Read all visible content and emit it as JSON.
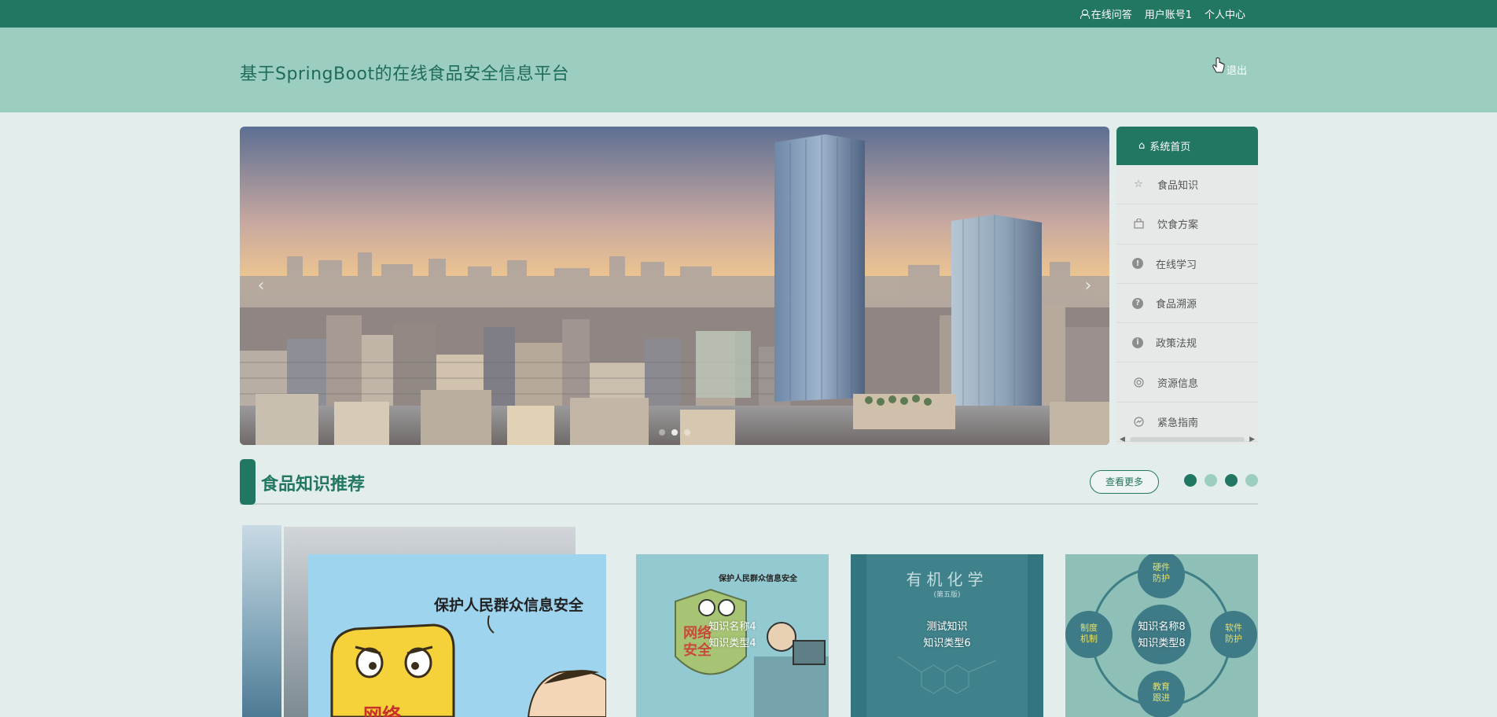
{
  "topbar": {
    "qa_label": "在线问答",
    "account_label": "用户账号1",
    "profile_label": "个人中心"
  },
  "header": {
    "site_title": "基于SpringBoot的在线食品安全信息平台",
    "logout_label": "退出"
  },
  "banner": {
    "prev_label": "‹",
    "next_label": "›",
    "slide_count": 3,
    "active_slide": 2
  },
  "sidemenu": {
    "home_label": "系统首页",
    "items": [
      {
        "label": "食品知识",
        "icon": "star-icon"
      },
      {
        "label": "饮食方案",
        "icon": "bag-icon"
      },
      {
        "label": "在线学习",
        "icon": "exclamation-icon"
      },
      {
        "label": "食品溯源",
        "icon": "question-icon"
      },
      {
        "label": "政策法规",
        "icon": "info-icon"
      },
      {
        "label": "资源信息",
        "icon": "lifebuoy-icon"
      },
      {
        "label": "紧急指南",
        "icon": "gauge-icon"
      }
    ]
  },
  "section": {
    "title": "食品知识推荐",
    "more_label": "查看更多"
  },
  "poster": {
    "headline": "保护人民群众信息安全",
    "badge": "网络"
  },
  "cards": [
    {
      "name": "知识名称4",
      "type": "知识类型4",
      "image_text": "保护人民群众信息安全",
      "shield_text": "网络安全"
    },
    {
      "name": "测试知识",
      "type": "知识类型6",
      "image_text": "有机化学",
      "image_subtext": "(第五版)"
    },
    {
      "name": "知识名称8",
      "type": "知识类型8",
      "nodes": [
        "硬件防护",
        "软件防护",
        "制度机制",
        "教育跟进"
      ]
    }
  ],
  "colors": {
    "primary": "#227763",
    "header_bg": "#9ccdc1",
    "page_bg": "#e3eeec"
  }
}
